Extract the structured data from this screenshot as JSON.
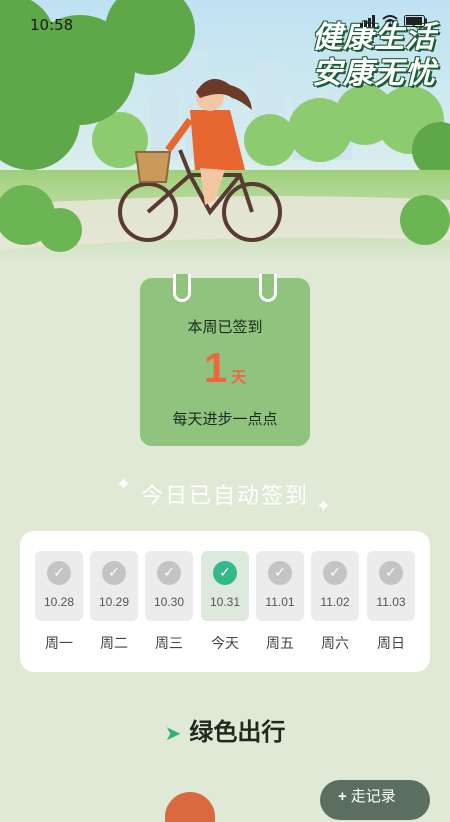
{
  "status_bar": {
    "time": "10:58"
  },
  "hero": {
    "slogan_line1": "健康生活",
    "slogan_line2": "安康无忧"
  },
  "week_card": {
    "label": "本周已签到",
    "count": "1",
    "unit": "天",
    "subtitle": "每天进步一点点"
  },
  "auto_sign": {
    "text": "今日已自动签到"
  },
  "days": [
    {
      "date": "10.28",
      "label": "周一",
      "checked": true,
      "today": false
    },
    {
      "date": "10.29",
      "label": "周二",
      "checked": true,
      "today": false
    },
    {
      "date": "10.30",
      "label": "周三",
      "checked": true,
      "today": false
    },
    {
      "date": "10.31",
      "label": "今天",
      "checked": true,
      "today": true
    },
    {
      "date": "11.01",
      "label": "周五",
      "checked": true,
      "today": false
    },
    {
      "date": "11.02",
      "label": "周六",
      "checked": true,
      "today": false
    },
    {
      "date": "11.03",
      "label": "周日",
      "checked": true,
      "today": false
    }
  ],
  "section": {
    "title": "绿色出行",
    "icon": "paper-plane-icon"
  },
  "record_button": {
    "label": "走记录"
  },
  "colors": {
    "background": "#dfe9d6",
    "card_green": "#8fc37e",
    "count_orange": "#f0673d",
    "today_check": "#35b98a"
  }
}
